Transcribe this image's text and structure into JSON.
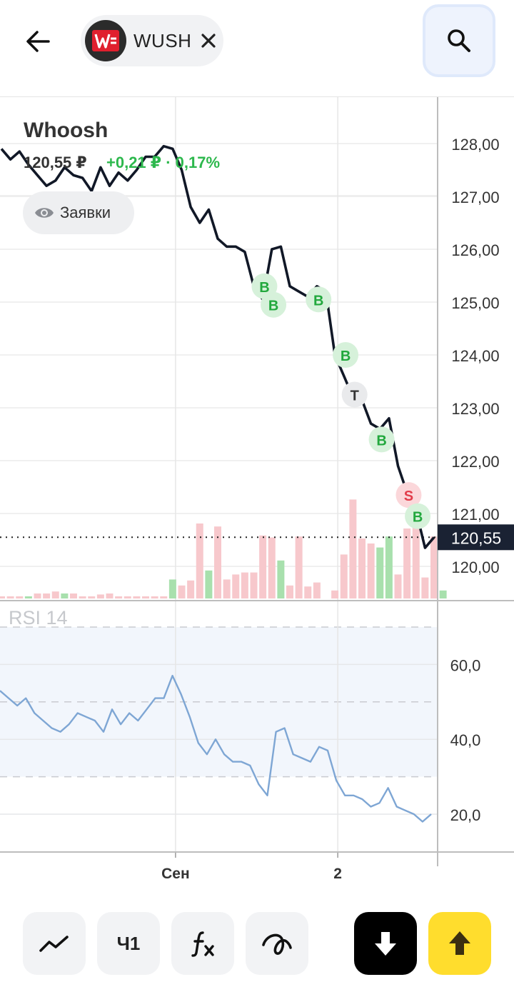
{
  "header": {
    "ticker": "WUSH",
    "icons": {
      "back": "arrow-left-icon",
      "close": "close-icon",
      "search": "search-icon",
      "logo": "whoosh-logo"
    }
  },
  "instrument": {
    "name": "Whoosh",
    "price": "120,55 ₽",
    "change": "+0,21 ₽ · 0,17%",
    "orders_label": "Заявки",
    "orders_icon": "eye-icon"
  },
  "colors": {
    "accent_yellow": "#ffdd2d",
    "up_green": "#2db84d",
    "down_red": "#e23c4a",
    "rsi_line": "#7ea6d4",
    "rsi_band": "#f2f6fc"
  },
  "rsi": {
    "label": "RSI 14"
  },
  "toolbar": {
    "interval_label": "Ч1",
    "icons": [
      "chart-type-icon",
      "interval",
      "indicators-icon",
      "drawing-icon",
      "sell-arrow-down-icon",
      "buy-arrow-up-icon"
    ]
  },
  "chart_data": [
    {
      "type": "line",
      "title": "Whoosh",
      "ylim": [
        119.5,
        128.6
      ],
      "y_ticks": [
        "128,00",
        "127,00",
        "126,00",
        "125,00",
        "124,00",
        "123,00",
        "122,00",
        "121,00",
        "120,00"
      ],
      "x_ticks": [
        {
          "label": "Сен",
          "index": 19
        },
        {
          "label": "2",
          "index": 37
        }
      ],
      "last_price_label": "120,55",
      "last_value": 120.55,
      "grid": true,
      "price": [
        127.9,
        127.7,
        127.85,
        127.6,
        127.4,
        127.2,
        127.3,
        127.55,
        127.4,
        127.35,
        127.1,
        127.55,
        127.2,
        127.45,
        127.3,
        127.5,
        127.75,
        127.75,
        127.95,
        127.9,
        127.5,
        126.8,
        126.5,
        126.75,
        126.2,
        126.05,
        126.05,
        125.95,
        125.3,
        125.05,
        126.0,
        126.05,
        125.3,
        125.2,
        125.1,
        125.3,
        125.2,
        124.0,
        123.6,
        123.2,
        123.15,
        122.7,
        122.6,
        122.8,
        121.9,
        121.4,
        121.05,
        120.35,
        120.55
      ],
      "volume": [
        0.02,
        0.02,
        0.02,
        0.02,
        0.05,
        0.05,
        0.07,
        0.05,
        0.05,
        0.02,
        0.02,
        0.04,
        0.05,
        0.02,
        0.02,
        0.02,
        0.02,
        0.02,
        0.02,
        0.19,
        0.13,
        0.18,
        0.75,
        0.28,
        0.72,
        0.19,
        0.24,
        0.26,
        0.26,
        0.63,
        0.61,
        0.38,
        0.13,
        0.62,
        0.12,
        0.16,
        0.0,
        0.08,
        0.44,
        0.99,
        0.6,
        0.55,
        0.51,
        0.62,
        0.24,
        0.7,
        0.83,
        0.21,
        0.62,
        0.08
      ],
      "volume_up": [
        false,
        false,
        false,
        true,
        false,
        false,
        false,
        true,
        false,
        false,
        false,
        false,
        false,
        false,
        false,
        false,
        false,
        false,
        false,
        true,
        false,
        false,
        false,
        true,
        false,
        false,
        false,
        false,
        false,
        false,
        false,
        true,
        false,
        false,
        false,
        false,
        false,
        false,
        false,
        false,
        false,
        false,
        true,
        true,
        false,
        false,
        false,
        false,
        false,
        true
      ],
      "markers": [
        {
          "label": "B",
          "index": 29.5,
          "value": 125.3,
          "kind": "buy"
        },
        {
          "label": "B",
          "index": 30.5,
          "value": 124.95,
          "kind": "buy"
        },
        {
          "label": "B",
          "index": 35.5,
          "value": 125.05,
          "kind": "buy"
        },
        {
          "label": "B",
          "index": 38.5,
          "value": 124.0,
          "kind": "buy"
        },
        {
          "label": "T",
          "index": 39.5,
          "value": 123.25,
          "kind": "neutral"
        },
        {
          "label": "B",
          "index": 42.5,
          "value": 122.4,
          "kind": "buy"
        },
        {
          "label": "S",
          "index": 45.5,
          "value": 121.35,
          "kind": "sell"
        },
        {
          "label": "B",
          "index": 46.5,
          "value": 120.95,
          "kind": "buy"
        }
      ]
    },
    {
      "type": "line",
      "title": "RSI 14",
      "ylim": [
        10,
        72
      ],
      "y_ticks": [
        "60,0",
        "40,0",
        "20,0"
      ],
      "band": [
        30,
        70
      ],
      "rsi": [
        53,
        51,
        49,
        51,
        47,
        45,
        43,
        42,
        44,
        47,
        46,
        45,
        42,
        48,
        44,
        47,
        45,
        48,
        51,
        51,
        57,
        52,
        46,
        39,
        36,
        40,
        36,
        34,
        34,
        33,
        28,
        25,
        42,
        43,
        36,
        35,
        34,
        38,
        37,
        29,
        25,
        25,
        24,
        22,
        23,
        27,
        22,
        21,
        20,
        18,
        20
      ]
    }
  ]
}
